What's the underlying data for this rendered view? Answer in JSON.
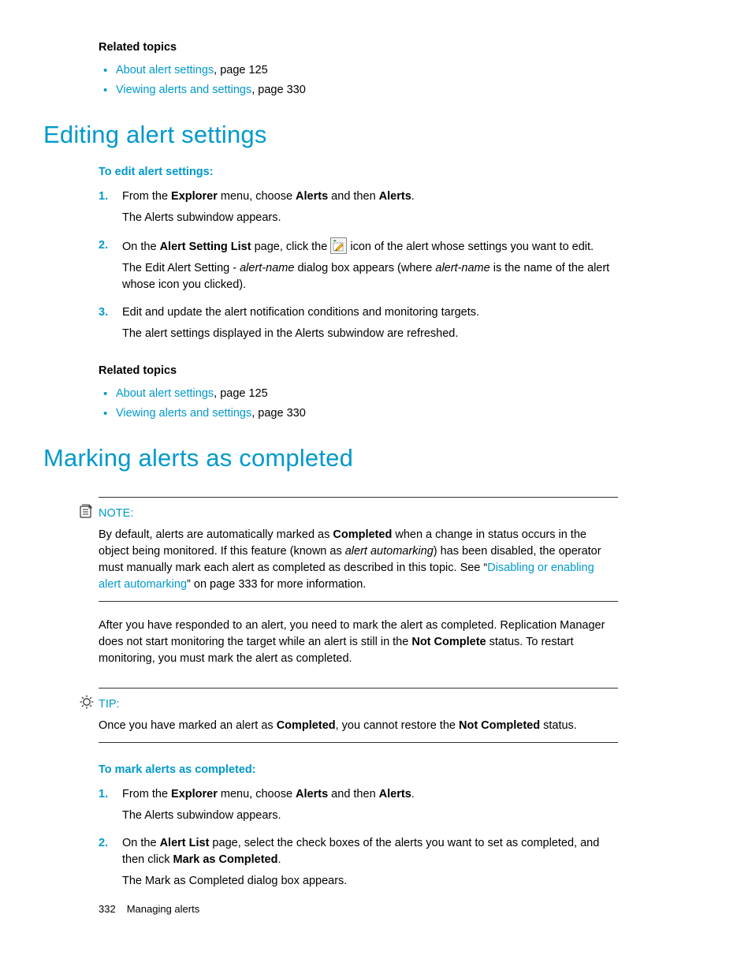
{
  "related_heading": "Related topics",
  "related1": [
    {
      "link": "About alert settings",
      "suffix": ", page 125"
    },
    {
      "link": "Viewing alerts and settings",
      "suffix": ", page 330"
    }
  ],
  "section1": {
    "title": "Editing alert settings",
    "proc_heading": "To edit alert settings:",
    "steps": {
      "s1_a": "From the ",
      "s1_b": "Explorer",
      "s1_c": " menu, choose ",
      "s1_d": "Alerts",
      "s1_e": " and then ",
      "s1_f": "Alerts",
      "s1_g": ".",
      "s1_result": "The Alerts subwindow appears.",
      "s2_a": "On the ",
      "s2_b": "Alert Setting List",
      "s2_c": " page, click the ",
      "s2_d": " icon of the alert whose settings you want to edit.",
      "s2_result_a": "The Edit Alert Setting - ",
      "s2_result_b": "alert-name",
      "s2_result_c": " dialog box appears (where ",
      "s2_result_d": "alert-name",
      "s2_result_e": " is the name of the alert whose icon you clicked).",
      "s3": "Edit and update the alert notification conditions and monitoring targets.",
      "s3_result": "The alert settings displayed in the Alerts subwindow are refreshed."
    }
  },
  "related2": [
    {
      "link": "About alert settings",
      "suffix": ", page 125"
    },
    {
      "link": "Viewing alerts and settings",
      "suffix": ", page 330"
    }
  ],
  "section2": {
    "title": "Marking alerts as completed",
    "note_label": "NOTE:",
    "note_a": "By default, alerts are automatically marked as ",
    "note_b": "Completed",
    "note_c": " when a change in status occurs in the object being monitored. If this feature (known as ",
    "note_d": "alert automarking",
    "note_e": ") has been disabled, the operator must manually mark each alert as completed as described in this topic. See “",
    "note_link": "Disabling or enabling alert automarking",
    "note_f": "” on page 333 for more information.",
    "para_a": "After you have responded to an alert, you need to mark the alert as completed. Replication Manager does not start monitoring the target while an alert is still in the ",
    "para_b": "Not Complete",
    "para_c": " status. To restart monitoring, you must mark the alert as completed.",
    "tip_label": "TIP:",
    "tip_a": "Once you have marked an alert as ",
    "tip_b": "Completed",
    "tip_c": ", you cannot restore the ",
    "tip_d": "Not Completed",
    "tip_e": " status.",
    "proc_heading": "To mark alerts as completed:",
    "steps": {
      "s1_a": "From the ",
      "s1_b": "Explorer",
      "s1_c": " menu, choose ",
      "s1_d": "Alerts",
      "s1_e": " and then ",
      "s1_f": "Alerts",
      "s1_g": ".",
      "s1_result": "The Alerts subwindow appears.",
      "s2_a": "On the ",
      "s2_b": "Alert List",
      "s2_c": " page, select the check boxes of the alerts you want to set as completed, and then click ",
      "s2_d": "Mark as Completed",
      "s2_e": ".",
      "s2_result": "The Mark as Completed dialog box appears."
    }
  },
  "footer": {
    "page": "332",
    "chapter": "Managing alerts"
  }
}
